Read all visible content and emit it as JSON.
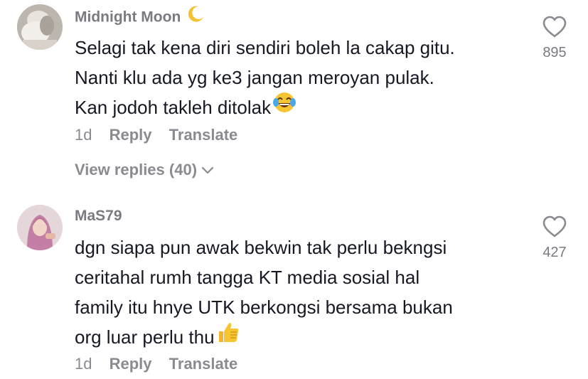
{
  "comments": [
    {
      "username": "Midnight Moon",
      "text_lines": [
        "Selagi tak kena diri sendiri boleh la cakap gitu.",
        "Nanti klu ada yg ke3 jangan meroyan pulak.",
        "Kan jodoh takleh ditolak"
      ],
      "trailing_emoji": "laughing-tears-emoji",
      "date": "1d",
      "reply_label": "Reply",
      "translate_label": "Translate",
      "view_replies": "View replies (40)",
      "likes": "895"
    },
    {
      "username": "MaS79",
      "text_lines": [
        "dgn siapa pun awak bekwin tak perlu bekngsi",
        "ceritahal rumh tangga KT media sosial hal",
        "family itu hnye UTK berkongsi bersama bukan",
        "org luar perlu thu"
      ],
      "trailing_emoji": "thumbs-up-emoji",
      "date": "1d",
      "reply_label": "Reply",
      "translate_label": "Translate",
      "likes": "427"
    }
  ],
  "colors": {
    "text": "#161823",
    "muted": "#8a8b91",
    "username": "#7a7b82",
    "background": "#ffffff"
  }
}
